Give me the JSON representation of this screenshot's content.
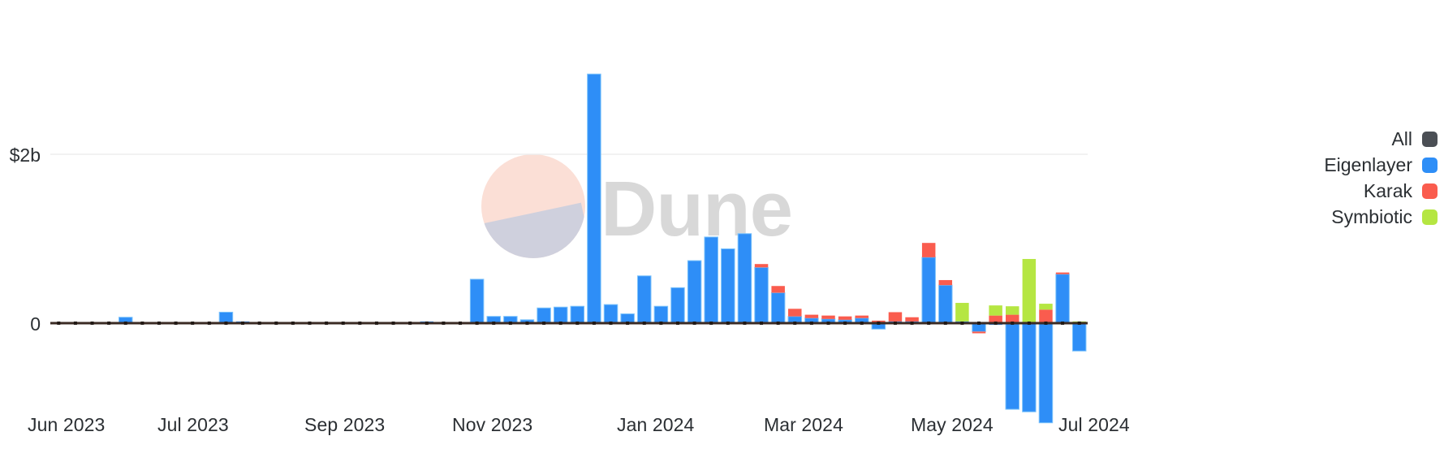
{
  "chart_data": {
    "type": "bar",
    "title": "",
    "subtitle": "",
    "xlabel": "",
    "ylabel": "",
    "stacked": true,
    "grid": true,
    "legend_position": "right",
    "ylim": [
      -1.25,
      3.15
    ],
    "y_ticks": [
      0,
      2
    ],
    "y_tick_labels": [
      "0",
      "$2b"
    ],
    "x_tick_labels": [
      "Jun 2023",
      "Jul 2023",
      "Sep 2023",
      "Nov 2023",
      "Jan 2024",
      "Mar 2024",
      "May 2024",
      "Jul 2024"
    ],
    "x_tick_indices": [
      0,
      5,
      13,
      21,
      30,
      38,
      47,
      55
    ],
    "categories": [
      "2023-06-05",
      "2023-06-12",
      "2023-06-19",
      "2023-06-26",
      "2023-07-03",
      "2023-07-10",
      "2023-07-17",
      "2023-07-24",
      "2023-07-31",
      "2023-08-07",
      "2023-08-14",
      "2023-08-21",
      "2023-08-28",
      "2023-09-04",
      "2023-09-11",
      "2023-09-18",
      "2023-09-25",
      "2023-10-02",
      "2023-10-09",
      "2023-10-16",
      "2023-10-23",
      "2023-10-30",
      "2023-11-06",
      "2023-11-13",
      "2023-11-20",
      "2023-11-27",
      "2023-12-04",
      "2023-12-11",
      "2023-12-18",
      "2023-12-25",
      "2024-01-01",
      "2024-01-08",
      "2024-01-15",
      "2024-01-22",
      "2024-01-29",
      "2024-02-05",
      "2024-02-12",
      "2024-02-19",
      "2024-02-26",
      "2024-03-04",
      "2024-03-11",
      "2024-03-18",
      "2024-03-25",
      "2024-04-01",
      "2024-04-08",
      "2024-04-15",
      "2024-04-22",
      "2024-04-29",
      "2024-05-06",
      "2024-05-13",
      "2024-05-20",
      "2024-05-27",
      "2024-06-03",
      "2024-06-10",
      "2024-06-17",
      "2024-06-24",
      "2024-07-01",
      "2024-07-08",
      "2024-07-15",
      "2024-07-22",
      "2024-07-29",
      "2024-08-05"
    ],
    "series": [
      {
        "name": "Eigenlayer",
        "color": "#2e8ef7",
        "values": [
          0.01,
          0.0,
          0.0,
          0.0,
          0.07,
          0.0,
          0.0,
          0.0,
          0.0,
          0.0,
          0.13,
          0.02,
          0.0,
          0.0,
          0.0,
          0.0,
          0.0,
          0.01,
          0.0,
          0.0,
          0.0,
          0.0,
          0.02,
          0.0,
          0.0,
          0.52,
          0.08,
          0.08,
          0.04,
          0.18,
          0.19,
          0.2,
          2.95,
          0.22,
          0.11,
          0.56,
          0.2,
          0.42,
          0.74,
          1.02,
          0.88,
          1.06,
          0.66,
          0.36,
          0.08,
          0.06,
          0.05,
          0.04,
          0.06,
          -0.07,
          0.02,
          0.02,
          0.78,
          0.45,
          0.02,
          -0.1,
          -0.02,
          -1.02,
          -1.05,
          -1.18,
          0.58,
          -0.33
        ]
      },
      {
        "name": "Karak",
        "color": "#fa5c4e",
        "values": [
          0.0,
          0.0,
          0.0,
          0.0,
          0.0,
          0.0,
          0.0,
          0.0,
          0.0,
          0.0,
          0.0,
          0.0,
          0.0,
          0.0,
          0.0,
          0.0,
          0.0,
          0.0,
          0.0,
          0.0,
          0.0,
          0.0,
          0.0,
          0.0,
          0.0,
          0.0,
          0.0,
          0.0,
          0.0,
          0.0,
          0.0,
          0.0,
          0.0,
          0.0,
          0.0,
          0.0,
          0.0,
          0.0,
          0.0,
          0.0,
          0.0,
          0.0,
          0.04,
          0.08,
          0.09,
          0.04,
          0.04,
          0.04,
          0.03,
          0.03,
          0.11,
          0.05,
          0.17,
          0.06,
          0.0,
          -0.02,
          0.09,
          0.1,
          0.0,
          0.16,
          0.02,
          0.0
        ]
      },
      {
        "name": "Symbiotic",
        "color": "#b5e642",
        "values": [
          0.0,
          0.0,
          0.0,
          0.0,
          0.0,
          0.0,
          0.0,
          0.0,
          0.0,
          0.0,
          0.0,
          0.0,
          0.0,
          0.0,
          0.0,
          0.0,
          0.0,
          0.0,
          0.0,
          0.0,
          0.0,
          0.0,
          0.0,
          0.0,
          0.0,
          0.0,
          0.0,
          0.0,
          0.0,
          0.0,
          0.0,
          0.0,
          0.0,
          0.0,
          0.0,
          0.0,
          0.0,
          0.0,
          0.0,
          0.0,
          0.0,
          0.0,
          0.0,
          0.0,
          0.0,
          0.0,
          0.0,
          0.0,
          0.0,
          0.0,
          0.0,
          0.0,
          0.0,
          0.0,
          0.22,
          0.0,
          0.12,
          0.1,
          0.76,
          0.07,
          0.0,
          0.02
        ]
      },
      {
        "name": "All",
        "color": "#4b4f55",
        "values": [
          0.0,
          0.0,
          0.0,
          0.0,
          0.0,
          0.0,
          0.0,
          0.0,
          0.0,
          0.0,
          0.0,
          0.0,
          0.0,
          0.0,
          0.0,
          0.0,
          0.0,
          0.0,
          0.0,
          0.0,
          0.0,
          0.0,
          0.0,
          0.0,
          0.0,
          0.0,
          0.0,
          0.0,
          0.0,
          0.0,
          0.0,
          0.0,
          0.0,
          0.0,
          0.0,
          0.0,
          0.0,
          0.0,
          0.0,
          0.0,
          0.0,
          0.0,
          0.0,
          0.0,
          0.0,
          0.0,
          0.0,
          0.0,
          0.0,
          0.0,
          0.0,
          0.0,
          0.0,
          0.0,
          0.0,
          0.0,
          0.0,
          0.0,
          0.0,
          0.0,
          0.0,
          0.0
        ]
      }
    ]
  },
  "legend": {
    "items": [
      {
        "label": "All",
        "color": "#4b4f55"
      },
      {
        "label": "Eigenlayer",
        "color": "#2e8ef7"
      },
      {
        "label": "Karak",
        "color": "#fa5c4e"
      },
      {
        "label": "Symbiotic",
        "color": "#b5e642"
      }
    ]
  },
  "watermark": {
    "text": "Dune",
    "logo_icon": "dune-logo-icon"
  },
  "colors": {
    "gridline": "#ededed",
    "zero_axis": "#3b2b24",
    "text": "#2b2f33",
    "background": "#ffffff"
  }
}
